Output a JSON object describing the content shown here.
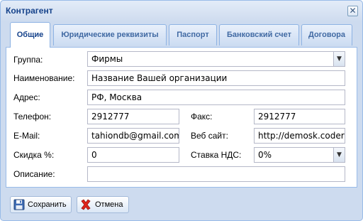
{
  "window": {
    "title": "Контрагент"
  },
  "tabs": [
    {
      "label": "Общие"
    },
    {
      "label": "Юридические реквизиты"
    },
    {
      "label": "Паспорт"
    },
    {
      "label": "Банковский счет"
    },
    {
      "label": "Договора"
    }
  ],
  "form": {
    "group": {
      "label": "Группа:",
      "value": "Фирмы"
    },
    "name": {
      "label": "Наименование:",
      "value": "Название Вашей организации"
    },
    "address": {
      "label": "Адрес:",
      "value": "РФ, Москва"
    },
    "phone": {
      "label": "Телефон:",
      "value": "2912777"
    },
    "fax": {
      "label": "Факс:",
      "value": "2912777"
    },
    "email": {
      "label": "E-Mail:",
      "value": "tahiondb@gmail.com"
    },
    "website": {
      "label": "Веб сайт:",
      "value": "http://demosk.coderu"
    },
    "discount": {
      "label": "Скидка %:",
      "value": "0"
    },
    "vat": {
      "label": "Ставка НДС:",
      "value": "0%"
    },
    "description": {
      "label": "Описание:",
      "value": ""
    }
  },
  "buttons": {
    "save": "Сохранить",
    "cancel": "Отмена"
  },
  "icons": {
    "close": "close-icon",
    "save": "floppy-disk-icon",
    "cancel": "red-x-icon",
    "dropdown": "chevron-down-icon"
  }
}
